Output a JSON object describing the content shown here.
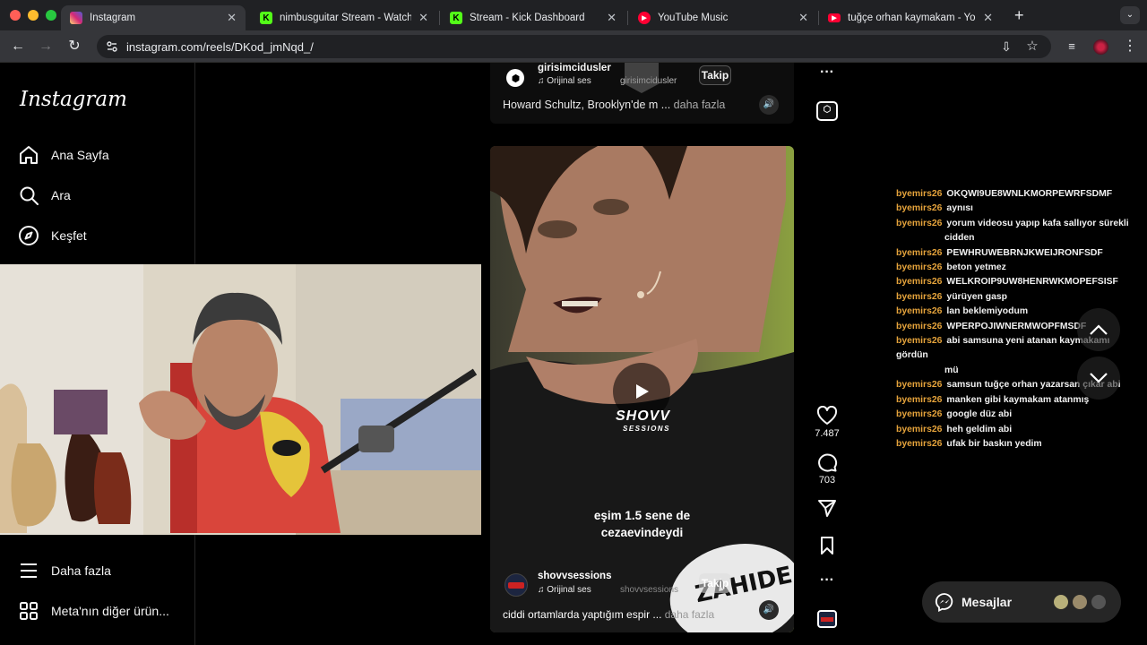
{
  "browser": {
    "tabs": [
      {
        "title": "Instagram",
        "icon": "instagram-icon",
        "color": "#d6249f"
      },
      {
        "title": "nimbusguitar Stream - Watch",
        "icon": "kick-icon",
        "color": "#53fc18"
      },
      {
        "title": "Stream - Kick Dashboard",
        "icon": "kick-icon",
        "color": "#53fc18"
      },
      {
        "title": "YouTube Music",
        "icon": "youtube-music-icon",
        "color": "#ff0033"
      },
      {
        "title": "tuğçe orhan kaymakam - You",
        "icon": "youtube-icon",
        "color": "#ff0033"
      }
    ],
    "url": "instagram.com/reels/DKod_jmNqd_/"
  },
  "sidebar": {
    "logo": "Instagram",
    "items": [
      {
        "label": "Ana Sayfa",
        "icon": "home-icon"
      },
      {
        "label": "Ara",
        "icon": "search-icon"
      },
      {
        "label": "Keşfet",
        "icon": "compass-icon"
      },
      {
        "label": "Daha fazla",
        "icon": "menu-icon"
      },
      {
        "label": "Meta'nın diğer ürün...",
        "icon": "meta-apps-icon"
      }
    ]
  },
  "reel_top": {
    "username": "girisimcidusler",
    "audio": "Orijinal ses",
    "audio_user": "girisimcidusler",
    "follow": "Takip",
    "caption": "Howard Schultz, Brooklyn'de m ...",
    "more": "daha fazla"
  },
  "reel_main": {
    "subtitle_line1": "eşim 1.5 sene de",
    "subtitle_line2": "cezaevindeydi",
    "watermark_line1": "SHOVV",
    "watermark_line2": "SESSIONS",
    "username": "shovvsessions",
    "audio": "Orijinal ses",
    "audio_user": "shovvsessions",
    "follow": "Takip",
    "caption": "ciddi ortamlarda yaptığım espir ...",
    "more": "daha fazla",
    "sticker": "ZAHIDE"
  },
  "actions": {
    "likes": "7.487",
    "comments": "703"
  },
  "chat": {
    "messages": [
      {
        "user": "byemirs26",
        "text": "OKQWI9UE8WNLKMORPEWRFSDMF"
      },
      {
        "user": "byemirs26",
        "text": "aynısı"
      },
      {
        "user": "byemirs26",
        "text": "yorum videosu yapıp kafa sallıyor sürekli",
        "cont": "cidden"
      },
      {
        "user": "byemirs26",
        "text": "PEWHRUWEBRNJKWEIJRONFSDF"
      },
      {
        "user": "byemirs26",
        "text": "beton yetmez"
      },
      {
        "user": "byemirs26",
        "text": "WELKROIP9UW8HENRWKMOPEFSISF"
      },
      {
        "user": "byemirs26",
        "text": "yürüyen gasp"
      },
      {
        "user": "byemirs26",
        "text": "lan beklemiyodum"
      },
      {
        "user": "byemirs26",
        "text": "WPERPOJIWNERMWOPFMSDF"
      },
      {
        "user": "byemirs26",
        "text": "abi samsuna yeni atanan kaymakamı gördün",
        "cont": "mü"
      },
      {
        "user": "byemirs26",
        "text": "samsun tuğçe orhan yazarsan çıkar abi"
      },
      {
        "user": "byemirs26",
        "text": "manken gibi kaymakam atanmış"
      },
      {
        "user": "byemirs26",
        "text": "google düz abi"
      },
      {
        "user": "byemirs26",
        "text": "heh geldim abi"
      },
      {
        "user": "byemirs26",
        "text": "ufak bir baskın yedim"
      }
    ]
  },
  "messages_button": {
    "label": "Mesajlar"
  }
}
